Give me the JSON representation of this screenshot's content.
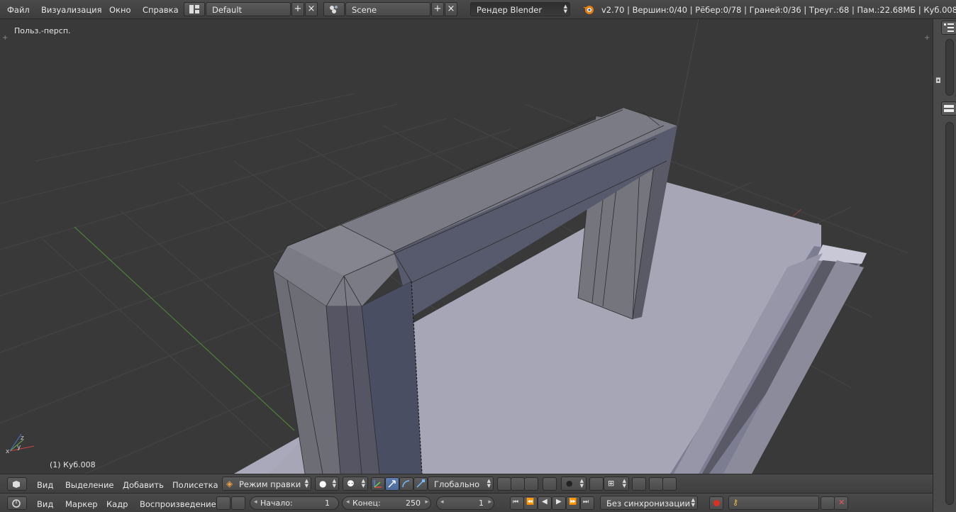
{
  "topbar": {
    "menus": [
      "Файл",
      "Визуализация",
      "Окно",
      "Справка"
    ],
    "screen_layout": "Default",
    "scene": "Scene",
    "render_engine": "Рендер Blender",
    "stats": "v2.70 | Вершин:0/40 | Рёбер:0/78 | Граней:0/36 | Треуг.:68 | Пам.:22.68МБ | Куб.008"
  },
  "viewport": {
    "view_label": "Польз.-персп.",
    "object_label": "(1) Куб.008",
    "axes": {
      "x": "x",
      "y": "y",
      "z": "z"
    }
  },
  "view3d_header": {
    "menus": [
      "Вид",
      "Выделение",
      "Добавить",
      "Полисетка"
    ],
    "mode": "Режим правки",
    "orientation": "Глобально"
  },
  "timeline": {
    "menus": [
      "Вид",
      "Маркер",
      "Кадр",
      "Воспроизведение"
    ],
    "start_label": "Начало:",
    "start_value": "1",
    "end_label": "Конец:",
    "end_value": "250",
    "current_frame": "1",
    "sync": "Без синхронизации"
  },
  "colors": {
    "background": "#393939",
    "mesh": "#6a6a78",
    "plane": "#a7a7b8",
    "accent_blue": "#5680c2"
  }
}
